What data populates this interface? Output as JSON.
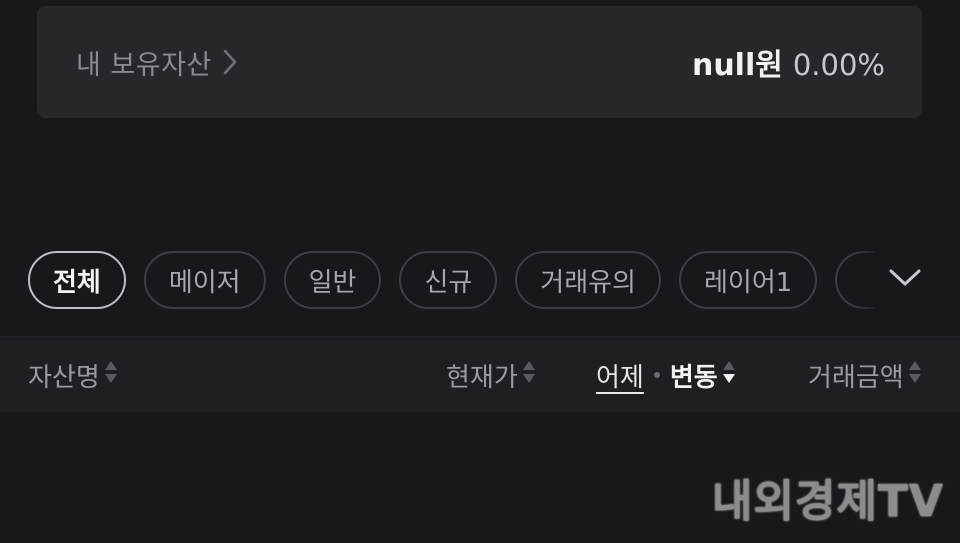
{
  "holdings": {
    "label": "내 보유자산",
    "value": "null원",
    "percent": "0.00%"
  },
  "filters": {
    "chips": [
      {
        "label": "전체",
        "active": true
      },
      {
        "label": "메이저",
        "active": false
      },
      {
        "label": "일반",
        "active": false
      },
      {
        "label": "신규",
        "active": false
      },
      {
        "label": "거래유의",
        "active": false
      },
      {
        "label": "레이어1",
        "active": false
      }
    ]
  },
  "table_header": {
    "asset_name": "자산명",
    "current_price": "현재가",
    "change_yesterday": "어제",
    "change": "변동",
    "trade_volume": "거래금액"
  },
  "watermark": "내외경제TV",
  "icons": {
    "holdings_chevron": "chevron-right-icon",
    "expand": "chevron-down-icon",
    "sort": "sort-icon"
  },
  "colors": {
    "background": "#17171c",
    "card": "#26262b",
    "header": "#1e1e23"
  }
}
